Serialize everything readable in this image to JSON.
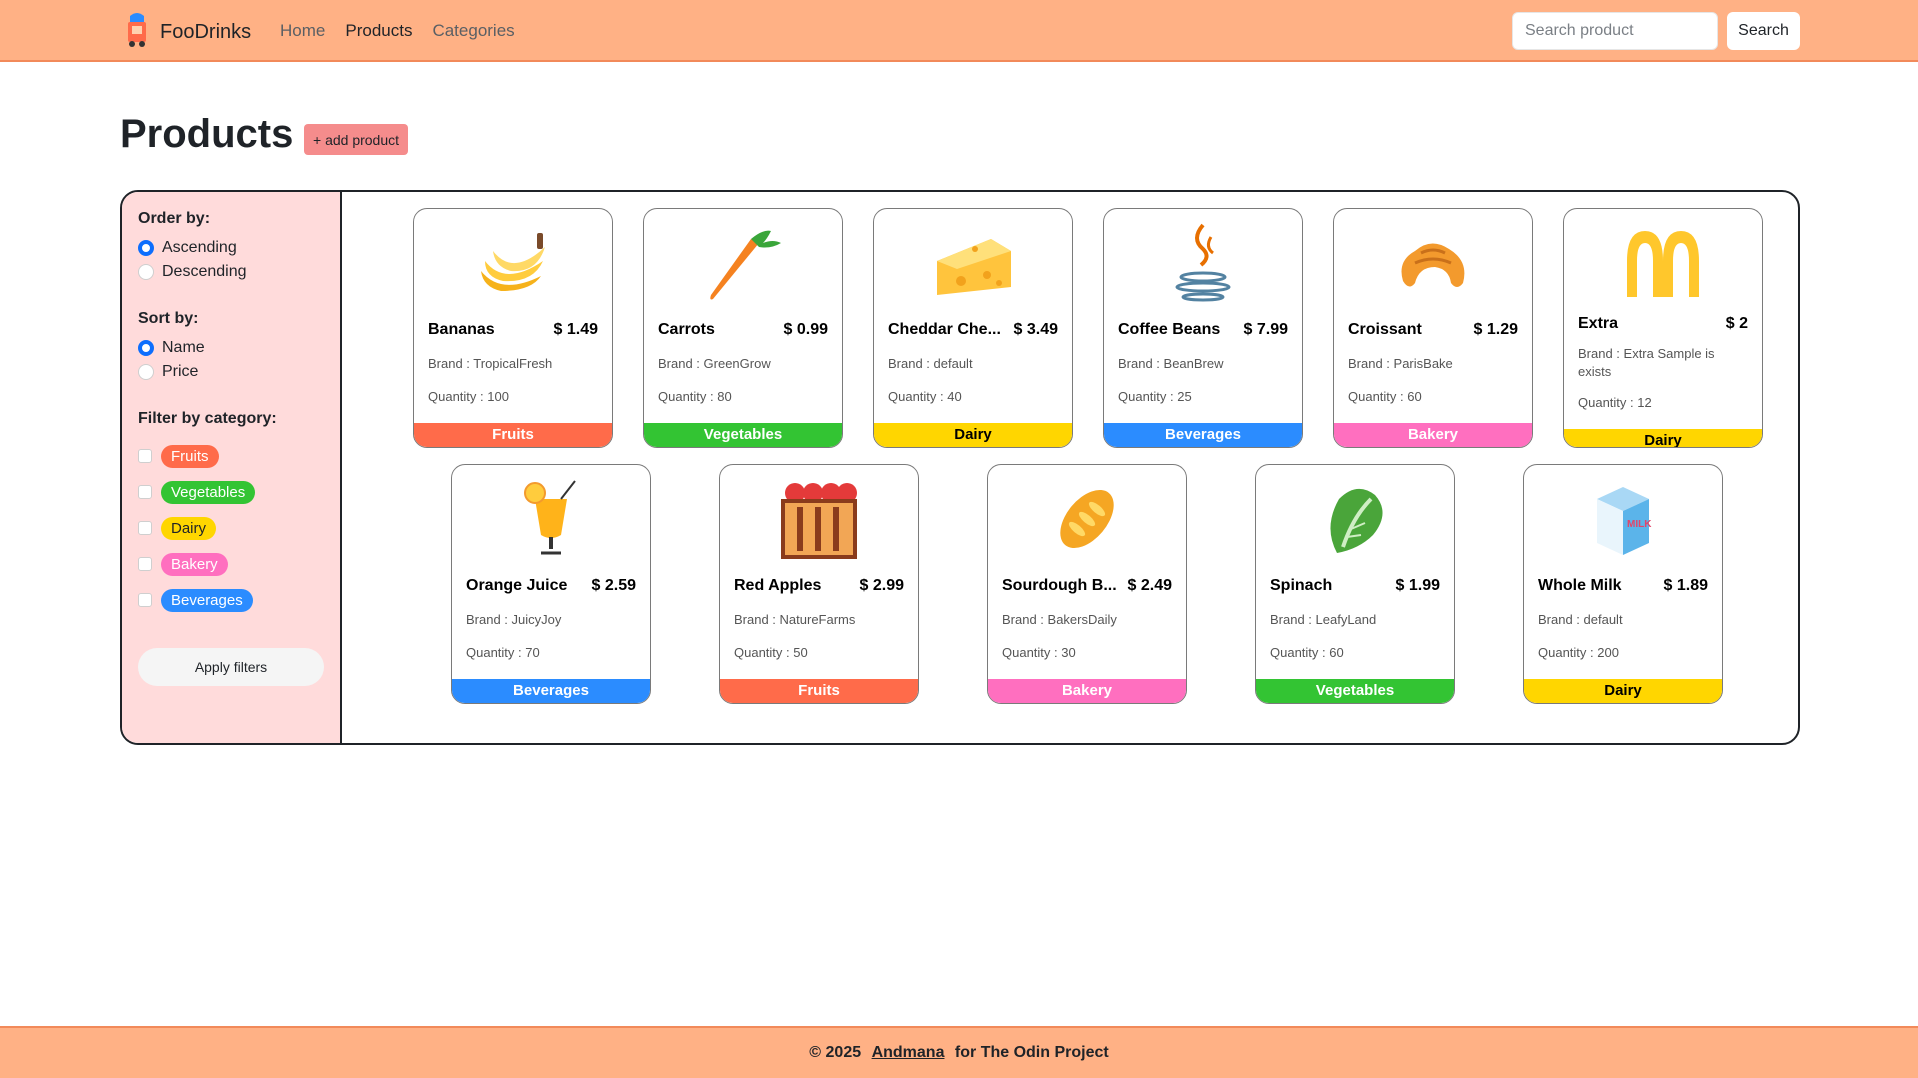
{
  "navbar": {
    "brand": "FooDrinks",
    "links": [
      {
        "label": "Home"
      },
      {
        "label": "Products"
      },
      {
        "label": "Categories"
      }
    ],
    "search_placeholder": "Search product",
    "search_button": "Search"
  },
  "page": {
    "title": "Products",
    "add_button": "+ add product"
  },
  "sidebar": {
    "order_title": "Order by:",
    "order_options": [
      "Ascending",
      "Descending"
    ],
    "sort_title": "Sort by:",
    "sort_options": [
      "Name",
      "Price"
    ],
    "filter_title": "Filter by category:",
    "categories": [
      {
        "label": "Fruits",
        "color": "#ff6b4a"
      },
      {
        "label": "Vegetables",
        "color": "#33c433"
      },
      {
        "label": "Dairy",
        "color": "#ffd600"
      },
      {
        "label": "Bakery",
        "color": "#ff6fbf"
      },
      {
        "label": "Beverages",
        "color": "#2b8cff"
      }
    ],
    "apply_button": "Apply filters"
  },
  "products": [
    {
      "name": "Bananas",
      "price": "$ 1.49",
      "brand": "Brand : TropicalFresh",
      "quantity": "Quantity : 100",
      "category": "Fruits",
      "icon": "banana-icon"
    },
    {
      "name": "Carrots",
      "price": "$ 0.99",
      "brand": "Brand : GreenGrow",
      "quantity": "Quantity : 80",
      "category": "Vegetables",
      "icon": "carrot-icon"
    },
    {
      "name": "Cheddar Che...",
      "price": "$ 3.49",
      "brand": "Brand : default",
      "quantity": "Quantity : 40",
      "category": "Dairy",
      "icon": "cheese-icon"
    },
    {
      "name": "Coffee Beans",
      "price": "$ 7.99",
      "brand": "Brand : BeanBrew",
      "quantity": "Quantity : 25",
      "category": "Beverages",
      "icon": "coffee-icon"
    },
    {
      "name": "Croissant",
      "price": "$ 1.29",
      "brand": "Brand : ParisBake",
      "quantity": "Quantity : 60",
      "category": "Bakery",
      "icon": "croissant-icon"
    },
    {
      "name": "Extra",
      "price": "$ 2",
      "brand": "Brand : Extra Sample is exists",
      "quantity": "Quantity : 12",
      "category": "Dairy",
      "icon": "arches-logo-icon"
    },
    {
      "name": "Orange Juice",
      "price": "$ 2.59",
      "brand": "Brand : JuicyJoy",
      "quantity": "Quantity : 70",
      "category": "Beverages",
      "icon": "juice-icon"
    },
    {
      "name": "Red Apples",
      "price": "$ 2.99",
      "brand": "Brand : NatureFarms",
      "quantity": "Quantity : 50",
      "category": "Fruits",
      "icon": "apple-basket-icon"
    },
    {
      "name": "Sourdough B...",
      "price": "$ 2.49",
      "brand": "Brand : BakersDaily",
      "quantity": "Quantity : 30",
      "category": "Bakery",
      "icon": "bread-icon"
    },
    {
      "name": "Spinach",
      "price": "$ 1.99",
      "brand": "Brand : LeafyLand",
      "quantity": "Quantity : 60",
      "category": "Vegetables",
      "icon": "spinach-icon"
    },
    {
      "name": "Whole Milk",
      "price": "$ 1.89",
      "brand": "Brand : default",
      "quantity": "Quantity : 200",
      "category": "Dairy",
      "icon": "milk-icon",
      "icon_text": "MILK"
    }
  ],
  "footer": {
    "prefix": "© 2025",
    "author": "Andmana",
    "suffix": "for The Odin Project"
  },
  "category_colors": {
    "Fruits": "#ff6b4a",
    "Vegetables": "#33c433",
    "Dairy": "#ffd600",
    "Bakery": "#ff6fbf",
    "Beverages": "#2b8cff"
  }
}
